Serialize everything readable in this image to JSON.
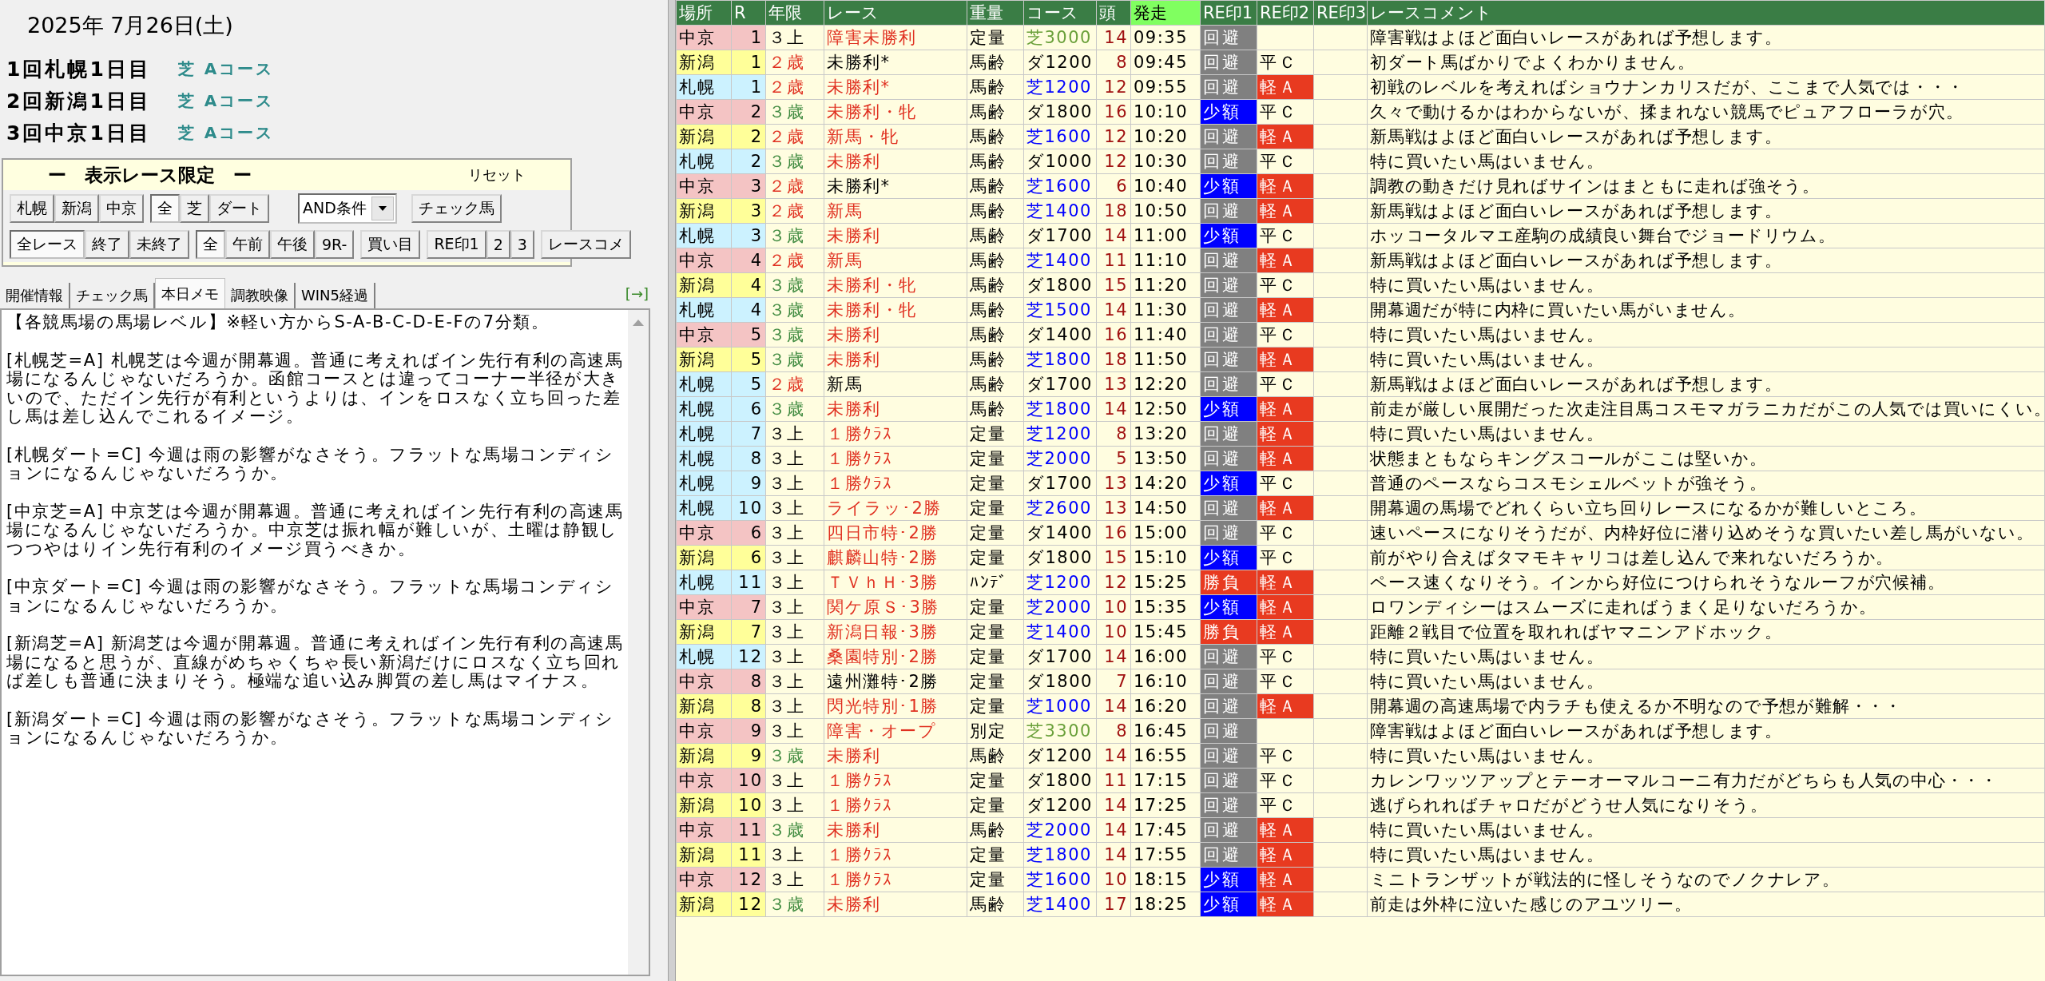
{
  "date": "2025年 7月26日(土)",
  "meetings": [
    {
      "name": "1回札幌1日目",
      "course": "芝 Aコース"
    },
    {
      "name": "2回新潟1日目",
      "course": "芝 Aコース"
    },
    {
      "name": "3回中京1日目",
      "course": "芝 Aコース"
    }
  ],
  "filter": {
    "title": "ー　表示レース限定　ー",
    "reset": "リセット",
    "venue_buttons": [
      {
        "label": "札幌",
        "selected": false
      },
      {
        "label": "新潟",
        "selected": false
      },
      {
        "label": "中京",
        "selected": false
      }
    ],
    "surface_buttons": [
      {
        "label": "全",
        "selected": true
      },
      {
        "label": "芝",
        "selected": false
      },
      {
        "label": "ダート",
        "selected": false
      }
    ],
    "condition": "AND条件",
    "check_button": "チェック馬",
    "status_buttons": [
      {
        "label": "全レース",
        "selected": true
      },
      {
        "label": "終了",
        "selected": false
      },
      {
        "label": "未終了",
        "selected": false
      }
    ],
    "time_buttons": [
      {
        "label": "全",
        "selected": true
      },
      {
        "label": "午前",
        "selected": false
      },
      {
        "label": "午後",
        "selected": false
      },
      {
        "label": "9R-",
        "selected": false
      }
    ],
    "buy_button": "買い目",
    "mark_buttons": [
      {
        "label": "RE印1",
        "selected": false
      },
      {
        "label": "2",
        "selected": false
      },
      {
        "label": "3",
        "selected": false
      }
    ],
    "comment_button": "レースコメ"
  },
  "tabs": [
    {
      "label": "開催情報",
      "selected": false
    },
    {
      "label": "チェック馬",
      "selected": false
    },
    {
      "label": "本日メモ",
      "selected": true
    },
    {
      "label": "調教映像",
      "selected": false
    },
    {
      "label": "WIN5経過",
      "selected": false
    }
  ],
  "tab_link": "[→]",
  "memo": [
    "【各競馬場の馬場レベル】※軽い方からS-A-B-C-D-E-Fの7分類。",
    "[札幌芝=A] 札幌芝は今週が開幕週。普通に考えればイン先行有利の高速馬場になるんじゃないだろうか。函館コースとは違ってコーナー半径が大きいので、ただイン先行が有利というよりは、インをロスなく立ち回った差し馬は差し込んでこれるイメージ。",
    "[札幌ダート=C] 今週は雨の影響がなさそう。フラットな馬場コンディションになるんじゃないだろうか。",
    "[中京芝=A] 中京芝は今週が開幕週。普通に考えればイン先行有利の高速馬場になるんじゃないだろうか。中京芝は振れ幅が難しいが、土曜は静観しつつやはりイン先行有利のイメージ買うべきか。",
    "[中京ダート=C] 今週は雨の影響がなさそう。フラットな馬場コンディションになるんじゃないだろうか。",
    "[新潟芝=A] 新潟芝は今週が開幕週。普通に考えればイン先行有利の高速馬場になると思うが、直線がめちゃくちゃ長い新潟だけにロスなく立ち回れば差しも普通に決まりそう。極端な追い込み脚質の差し馬はマイナス。",
    "[新潟ダート=C] 今週は雨の影響がなさそう。フラットな馬場コンディションになるんじゃないだろうか。"
  ],
  "table": {
    "columns": [
      {
        "label": "場所",
        "selected": false
      },
      {
        "label": "R",
        "selected": false
      },
      {
        "label": "年限",
        "selected": false
      },
      {
        "label": "レース",
        "selected": false
      },
      {
        "label": "重量",
        "selected": false
      },
      {
        "label": "コース",
        "selected": false
      },
      {
        "label": "頭",
        "selected": false
      },
      {
        "label": "発走",
        "selected": true
      },
      {
        "label": "RE印1",
        "selected": false
      },
      {
        "label": "RE印2",
        "selected": false
      },
      {
        "label": "RE印3",
        "selected": false
      },
      {
        "label": "レースコメント",
        "selected": false
      }
    ],
    "rows": [
      {
        "venue": "中京",
        "color": "#f4c4c4",
        "r": "1",
        "age": {
          "text": "３上",
          "kind": "upper"
        },
        "race": "障害未勝利",
        "race_highlight": true,
        "weight": "定量",
        "course": {
          "text": "芝3000",
          "kind": "jump"
        },
        "runners": "14",
        "time": "09:35",
        "mark1": {
          "text": "回避",
          "kind": "avoid"
        },
        "comment": "障害戦はよほど面白いレースがあれば予想します。"
      },
      {
        "venue": "新潟",
        "color": "#ffff99",
        "r": "1",
        "age": {
          "text": "２歳",
          "kind": "two"
        },
        "race": "未勝利*",
        "race_highlight": false,
        "weight": "馬齢",
        "course": {
          "text": "ダ1200",
          "kind": "dirt"
        },
        "runners": "8",
        "time": "09:45",
        "mark1": {
          "text": "回避",
          "kind": "avoid"
        },
        "mark2": {
          "text": "平Ｃ",
          "kind": "flat"
        },
        "comment": "初ダート馬ばかりでよくわかりません。"
      },
      {
        "venue": "札幌",
        "color": "#ccf2ff",
        "r": "1",
        "age": {
          "text": "２歳",
          "kind": "two"
        },
        "race": "未勝利*",
        "race_highlight": true,
        "weight": "馬齢",
        "course": {
          "text": "芝1200",
          "kind": "turf"
        },
        "runners": "12",
        "time": "09:55",
        "mark1": {
          "text": "回避",
          "kind": "avoid"
        },
        "mark2": {
          "text": "軽Ａ",
          "kind": "light"
        },
        "comment": "初戦のレベルを考えればショウナンカリスだが、ここまで人気では・・・"
      },
      {
        "venue": "中京",
        "color": "#f4c4c4",
        "r": "2",
        "age": {
          "text": "３歳",
          "kind": "three"
        },
        "race": "未勝利・牝",
        "race_highlight": true,
        "weight": "馬齢",
        "course": {
          "text": "ダ1800",
          "kind": "dirt"
        },
        "runners": "16",
        "time": "10:10",
        "mark1": {
          "text": "少額",
          "kind": "small"
        },
        "mark2": {
          "text": "平Ｃ",
          "kind": "flat"
        },
        "comment": "久々で動けるかはわからないが、揉まれない競馬でピュアフローラが穴。"
      },
      {
        "venue": "新潟",
        "color": "#ffff99",
        "r": "2",
        "age": {
          "text": "２歳",
          "kind": "two"
        },
        "race": "新馬・牝",
        "race_highlight": true,
        "weight": "馬齢",
        "course": {
          "text": "芝1600",
          "kind": "turf"
        },
        "runners": "12",
        "time": "10:20",
        "mark1": {
          "text": "回避",
          "kind": "avoid"
        },
        "mark2": {
          "text": "軽Ａ",
          "kind": "light"
        },
        "comment": "新馬戦はよほど面白いレースがあれば予想します。"
      },
      {
        "venue": "札幌",
        "color": "#ccf2ff",
        "r": "2",
        "age": {
          "text": "３歳",
          "kind": "three"
        },
        "race": "未勝利",
        "race_highlight": true,
        "weight": "馬齢",
        "course": {
          "text": "ダ1000",
          "kind": "dirt"
        },
        "runners": "12",
        "time": "10:30",
        "mark1": {
          "text": "回避",
          "kind": "avoid"
        },
        "mark2": {
          "text": "平Ｃ",
          "kind": "flat"
        },
        "comment": "特に買いたい馬はいません。"
      },
      {
        "venue": "中京",
        "color": "#f4c4c4",
        "r": "3",
        "age": {
          "text": "２歳",
          "kind": "two"
        },
        "race": "未勝利*",
        "race_highlight": false,
        "weight": "馬齢",
        "course": {
          "text": "芝1600",
          "kind": "turf"
        },
        "runners": "6",
        "time": "10:40",
        "mark1": {
          "text": "少額",
          "kind": "small"
        },
        "mark2": {
          "text": "軽Ａ",
          "kind": "light"
        },
        "comment": "調教の動きだけ見ればサインはまともに走れば強そう。"
      },
      {
        "venue": "新潟",
        "color": "#ffff99",
        "r": "3",
        "age": {
          "text": "２歳",
          "kind": "two"
        },
        "race": "新馬",
        "race_highlight": true,
        "weight": "馬齢",
        "course": {
          "text": "芝1400",
          "kind": "turf"
        },
        "runners": "18",
        "time": "10:50",
        "mark1": {
          "text": "回避",
          "kind": "avoid"
        },
        "mark2": {
          "text": "軽Ａ",
          "kind": "light"
        },
        "comment": "新馬戦はよほど面白いレースがあれば予想します。"
      },
      {
        "venue": "札幌",
        "color": "#ccf2ff",
        "r": "3",
        "age": {
          "text": "３歳",
          "kind": "three"
        },
        "race": "未勝利",
        "race_highlight": true,
        "weight": "馬齢",
        "course": {
          "text": "ダ1700",
          "kind": "dirt"
        },
        "runners": "14",
        "time": "11:00",
        "mark1": {
          "text": "少額",
          "kind": "small"
        },
        "mark2": {
          "text": "平Ｃ",
          "kind": "flat"
        },
        "comment": "ホッコータルマエ産駒の成績良い舞台でジョードリウム。"
      },
      {
        "venue": "中京",
        "color": "#f4c4c4",
        "r": "4",
        "age": {
          "text": "２歳",
          "kind": "two"
        },
        "race": "新馬",
        "race_highlight": true,
        "weight": "馬齢",
        "course": {
          "text": "芝1400",
          "kind": "turf"
        },
        "runners": "11",
        "time": "11:10",
        "mark1": {
          "text": "回避",
          "kind": "avoid"
        },
        "mark2": {
          "text": "軽Ａ",
          "kind": "light"
        },
        "comment": "新馬戦はよほど面白いレースがあれば予想します。"
      },
      {
        "venue": "新潟",
        "color": "#ffff99",
        "r": "4",
        "age": {
          "text": "３歳",
          "kind": "three"
        },
        "race": "未勝利・牝",
        "race_highlight": true,
        "weight": "馬齢",
        "course": {
          "text": "ダ1800",
          "kind": "dirt"
        },
        "runners": "15",
        "time": "11:20",
        "mark1": {
          "text": "回避",
          "kind": "avoid"
        },
        "mark2": {
          "text": "平Ｃ",
          "kind": "flat"
        },
        "comment": "特に買いたい馬はいません。"
      },
      {
        "venue": "札幌",
        "color": "#ccf2ff",
        "r": "4",
        "age": {
          "text": "３歳",
          "kind": "three"
        },
        "race": "未勝利・牝",
        "race_highlight": true,
        "weight": "馬齢",
        "course": {
          "text": "芝1500",
          "kind": "turf"
        },
        "runners": "14",
        "time": "11:30",
        "mark1": {
          "text": "回避",
          "kind": "avoid"
        },
        "mark2": {
          "text": "軽Ａ",
          "kind": "light"
        },
        "comment": "開幕週だが特に内枠に買いたい馬がいません。"
      },
      {
        "venue": "中京",
        "color": "#f4c4c4",
        "r": "5",
        "age": {
          "text": "３歳",
          "kind": "three"
        },
        "race": "未勝利",
        "race_highlight": true,
        "weight": "馬齢",
        "course": {
          "text": "ダ1400",
          "kind": "dirt"
        },
        "runners": "16",
        "time": "11:40",
        "mark1": {
          "text": "回避",
          "kind": "avoid"
        },
        "mark2": {
          "text": "平Ｃ",
          "kind": "flat"
        },
        "comment": "特に買いたい馬はいません。"
      },
      {
        "venue": "新潟",
        "color": "#ffff99",
        "r": "5",
        "age": {
          "text": "３歳",
          "kind": "three"
        },
        "race": "未勝利",
        "race_highlight": true,
        "weight": "馬齢",
        "course": {
          "text": "芝1800",
          "kind": "turf"
        },
        "runners": "18",
        "time": "11:50",
        "mark1": {
          "text": "回避",
          "kind": "avoid"
        },
        "mark2": {
          "text": "軽Ａ",
          "kind": "light"
        },
        "comment": "特に買いたい馬はいません。"
      },
      {
        "venue": "札幌",
        "color": "#ccf2ff",
        "r": "5",
        "age": {
          "text": "２歳",
          "kind": "two"
        },
        "race": "新馬",
        "race_highlight": false,
        "weight": "馬齢",
        "course": {
          "text": "ダ1700",
          "kind": "dirt"
        },
        "runners": "13",
        "time": "12:20",
        "mark1": {
          "text": "回避",
          "kind": "avoid"
        },
        "mark2": {
          "text": "平Ｃ",
          "kind": "flat"
        },
        "comment": "新馬戦はよほど面白いレースがあれば予想します。"
      },
      {
        "venue": "札幌",
        "color": "#ccf2ff",
        "r": "6",
        "age": {
          "text": "３歳",
          "kind": "three"
        },
        "race": "未勝利",
        "race_highlight": true,
        "weight": "馬齢",
        "course": {
          "text": "芝1800",
          "kind": "turf"
        },
        "runners": "14",
        "time": "12:50",
        "mark1": {
          "text": "少額",
          "kind": "small"
        },
        "mark2": {
          "text": "軽Ａ",
          "kind": "light"
        },
        "comment": "前走が厳しい展開だった次走注目馬コスモマガラニカだがこの人気では買いにくい。"
      },
      {
        "venue": "札幌",
        "color": "#ccf2ff",
        "r": "7",
        "age": {
          "text": "３上",
          "kind": "upper"
        },
        "race": "１勝ｸﾗｽ",
        "race_highlight": true,
        "weight": "定量",
        "course": {
          "text": "芝1200",
          "kind": "turf"
        },
        "runners": "8",
        "time": "13:20",
        "mark1": {
          "text": "回避",
          "kind": "avoid"
        },
        "mark2": {
          "text": "軽Ａ",
          "kind": "light"
        },
        "comment": "特に買いたい馬はいません。"
      },
      {
        "venue": "札幌",
        "color": "#ccf2ff",
        "r": "8",
        "age": {
          "text": "３上",
          "kind": "upper"
        },
        "race": "１勝ｸﾗｽ",
        "race_highlight": true,
        "weight": "定量",
        "course": {
          "text": "芝2000",
          "kind": "turf"
        },
        "runners": "5",
        "time": "13:50",
        "mark1": {
          "text": "回避",
          "kind": "avoid"
        },
        "mark2": {
          "text": "軽Ａ",
          "kind": "light"
        },
        "comment": "状態まともならキングスコールがここは堅いか。"
      },
      {
        "venue": "札幌",
        "color": "#ccf2ff",
        "r": "9",
        "age": {
          "text": "３上",
          "kind": "upper"
        },
        "race": "１勝ｸﾗｽ",
        "race_highlight": true,
        "weight": "定量",
        "course": {
          "text": "ダ1700",
          "kind": "dirt"
        },
        "runners": "13",
        "time": "14:20",
        "mark1": {
          "text": "少額",
          "kind": "small"
        },
        "mark2": {
          "text": "平Ｃ",
          "kind": "flat"
        },
        "comment": "普通のペースならコスモシェルベットが強そう。"
      },
      {
        "venue": "札幌",
        "color": "#ccf2ff",
        "r": "10",
        "age": {
          "text": "３上",
          "kind": "upper"
        },
        "race": "ライラッ･2勝",
        "race_highlight": true,
        "weight": "定量",
        "course": {
          "text": "芝2600",
          "kind": "turf"
        },
        "runners": "13",
        "time": "14:50",
        "mark1": {
          "text": "回避",
          "kind": "avoid"
        },
        "mark2": {
          "text": "軽Ａ",
          "kind": "light"
        },
        "comment": "開幕週の馬場でどれくらい立ち回りレースになるかが難しいところ。"
      },
      {
        "venue": "中京",
        "color": "#f4c4c4",
        "r": "6",
        "age": {
          "text": "３上",
          "kind": "upper"
        },
        "race": "四日市特･2勝",
        "race_highlight": true,
        "weight": "定量",
        "course": {
          "text": "ダ1400",
          "kind": "dirt"
        },
        "runners": "16",
        "time": "15:00",
        "mark1": {
          "text": "回避",
          "kind": "avoid"
        },
        "mark2": {
          "text": "平Ｃ",
          "kind": "flat"
        },
        "comment": "速いペースになりそうだが、内枠好位に潜り込めそうな買いたい差し馬がいない。"
      },
      {
        "venue": "新潟",
        "color": "#ffff99",
        "r": "6",
        "age": {
          "text": "３上",
          "kind": "upper"
        },
        "race": "麒麟山特･2勝",
        "race_highlight": true,
        "weight": "定量",
        "course": {
          "text": "ダ1800",
          "kind": "dirt"
        },
        "runners": "15",
        "time": "15:10",
        "mark1": {
          "text": "少額",
          "kind": "small"
        },
        "mark2": {
          "text": "平Ｃ",
          "kind": "flat"
        },
        "comment": "前がやり合えばタマモキャリコは差し込んで来れないだろうか。"
      },
      {
        "venue": "札幌",
        "color": "#ccf2ff",
        "r": "11",
        "age": {
          "text": "３上",
          "kind": "upper"
        },
        "race": "ＴＶｈＨ･3勝",
        "race_highlight": true,
        "weight": "ﾊﾝﾃﾞ",
        "course": {
          "text": "芝1200",
          "kind": "turf"
        },
        "runners": "12",
        "time": "15:25",
        "mark1": {
          "text": "勝負",
          "kind": "bet"
        },
        "mark2": {
          "text": "軽Ａ",
          "kind": "light"
        },
        "comment": "ペース速くなりそう。インから好位につけられそうなルーフが穴候補。"
      },
      {
        "venue": "中京",
        "color": "#f4c4c4",
        "r": "7",
        "age": {
          "text": "３上",
          "kind": "upper"
        },
        "race": "関ケ原Ｓ･3勝",
        "race_highlight": true,
        "weight": "定量",
        "course": {
          "text": "芝2000",
          "kind": "turf"
        },
        "runners": "10",
        "time": "15:35",
        "mark1": {
          "text": "少額",
          "kind": "small"
        },
        "mark2": {
          "text": "軽Ａ",
          "kind": "light"
        },
        "comment": "ロワンディシーはスムーズに走ればうまく足りないだろうか。"
      },
      {
        "venue": "新潟",
        "color": "#ffff99",
        "r": "7",
        "age": {
          "text": "３上",
          "kind": "upper"
        },
        "race": "新潟日報･3勝",
        "race_highlight": true,
        "weight": "定量",
        "course": {
          "text": "芝1400",
          "kind": "turf"
        },
        "runners": "10",
        "time": "15:45",
        "mark1": {
          "text": "勝負",
          "kind": "bet"
        },
        "mark2": {
          "text": "軽Ａ",
          "kind": "light"
        },
        "comment": "距離２戦目で位置を取れればヤマニンアドホック。"
      },
      {
        "venue": "札幌",
        "color": "#ccf2ff",
        "r": "12",
        "age": {
          "text": "３上",
          "kind": "upper"
        },
        "race": "桑園特別･2勝",
        "race_highlight": true,
        "weight": "定量",
        "course": {
          "text": "ダ1700",
          "kind": "dirt"
        },
        "runners": "14",
        "time": "16:00",
        "mark1": {
          "text": "回避",
          "kind": "avoid"
        },
        "mark2": {
          "text": "平Ｃ",
          "kind": "flat"
        },
        "comment": "特に買いたい馬はいません。"
      },
      {
        "venue": "中京",
        "color": "#f4c4c4",
        "r": "8",
        "age": {
          "text": "３上",
          "kind": "upper"
        },
        "race": "遠州灘特･2勝",
        "race_highlight": false,
        "weight": "定量",
        "course": {
          "text": "ダ1800",
          "kind": "dirt"
        },
        "runners": "7",
        "time": "16:10",
        "mark1": {
          "text": "回避",
          "kind": "avoid"
        },
        "mark2": {
          "text": "平Ｃ",
          "kind": "flat"
        },
        "comment": "特に買いたい馬はいません。"
      },
      {
        "venue": "新潟",
        "color": "#ffff99",
        "r": "8",
        "age": {
          "text": "３上",
          "kind": "upper"
        },
        "race": "閃光特別･1勝",
        "race_highlight": true,
        "weight": "定量",
        "course": {
          "text": "芝1000",
          "kind": "turf"
        },
        "runners": "14",
        "time": "16:20",
        "mark1": {
          "text": "回避",
          "kind": "avoid"
        },
        "mark2": {
          "text": "軽Ａ",
          "kind": "light"
        },
        "comment": "開幕週の高速馬場で内ラチも使えるか不明なので予想が難解・・・"
      },
      {
        "venue": "中京",
        "color": "#f4c4c4",
        "r": "9",
        "age": {
          "text": "３上",
          "kind": "upper"
        },
        "race": "障害・オープ",
        "race_highlight": true,
        "weight": "別定",
        "course": {
          "text": "芝3300",
          "kind": "jump"
        },
        "runners": "8",
        "time": "16:45",
        "mark1": {
          "text": "回避",
          "kind": "avoid"
        },
        "comment": "障害戦はよほど面白いレースがあれば予想します。"
      },
      {
        "venue": "新潟",
        "color": "#ffff99",
        "r": "9",
        "age": {
          "text": "３歳",
          "kind": "three"
        },
        "race": "未勝利",
        "race_highlight": true,
        "weight": "馬齢",
        "course": {
          "text": "ダ1200",
          "kind": "dirt"
        },
        "runners": "14",
        "time": "16:55",
        "mark1": {
          "text": "回避",
          "kind": "avoid"
        },
        "mark2": {
          "text": "平Ｃ",
          "kind": "flat"
        },
        "comment": "特に買いたい馬はいません。"
      },
      {
        "venue": "中京",
        "color": "#f4c4c4",
        "r": "10",
        "age": {
          "text": "３上",
          "kind": "upper"
        },
        "race": "１勝ｸﾗｽ",
        "race_highlight": true,
        "weight": "定量",
        "course": {
          "text": "ダ1800",
          "kind": "dirt"
        },
        "runners": "11",
        "time": "17:15",
        "mark1": {
          "text": "回避",
          "kind": "avoid"
        },
        "mark2": {
          "text": "平Ｃ",
          "kind": "flat"
        },
        "comment": "カレンワッツアップとテーオーマルコーニ有力だがどちらも人気の中心・・・"
      },
      {
        "venue": "新潟",
        "color": "#ffff99",
        "r": "10",
        "age": {
          "text": "３上",
          "kind": "upper"
        },
        "race": "１勝ｸﾗｽ",
        "race_highlight": true,
        "weight": "定量",
        "course": {
          "text": "ダ1200",
          "kind": "dirt"
        },
        "runners": "14",
        "time": "17:25",
        "mark1": {
          "text": "回避",
          "kind": "avoid"
        },
        "mark2": {
          "text": "平Ｃ",
          "kind": "flat"
        },
        "comment": "逃げられればチャロだがどうせ人気になりそう。"
      },
      {
        "venue": "中京",
        "color": "#f4c4c4",
        "r": "11",
        "age": {
          "text": "３歳",
          "kind": "three"
        },
        "race": "未勝利",
        "race_highlight": true,
        "weight": "馬齢",
        "course": {
          "text": "芝2000",
          "kind": "turf"
        },
        "runners": "14",
        "time": "17:45",
        "mark1": {
          "text": "回避",
          "kind": "avoid"
        },
        "mark2": {
          "text": "軽Ａ",
          "kind": "light"
        },
        "comment": "特に買いたい馬はいません。"
      },
      {
        "venue": "新潟",
        "color": "#ffff99",
        "r": "11",
        "age": {
          "text": "３上",
          "kind": "upper"
        },
        "race": "１勝ｸﾗｽ",
        "race_highlight": true,
        "weight": "定量",
        "course": {
          "text": "芝1800",
          "kind": "turf"
        },
        "runners": "14",
        "time": "17:55",
        "mark1": {
          "text": "回避",
          "kind": "avoid"
        },
        "mark2": {
          "text": "軽Ａ",
          "kind": "light"
        },
        "comment": "特に買いたい馬はいません。"
      },
      {
        "venue": "中京",
        "color": "#f4c4c4",
        "r": "12",
        "age": {
          "text": "３上",
          "kind": "upper"
        },
        "race": "１勝ｸﾗｽ",
        "race_highlight": true,
        "weight": "定量",
        "course": {
          "text": "芝1600",
          "kind": "turf"
        },
        "runners": "10",
        "time": "18:15",
        "mark1": {
          "text": "少額",
          "kind": "small"
        },
        "mark2": {
          "text": "軽Ａ",
          "kind": "light"
        },
        "comment": "ミニトランザットが戦法的に怪しそうなのでノクナレア。"
      },
      {
        "venue": "新潟",
        "color": "#ffff99",
        "r": "12",
        "age": {
          "text": "３歳",
          "kind": "three"
        },
        "race": "未勝利",
        "race_highlight": true,
        "weight": "馬齢",
        "course": {
          "text": "芝1400",
          "kind": "turf"
        },
        "runners": "17",
        "time": "18:25",
        "mark1": {
          "text": "少額",
          "kind": "small"
        },
        "mark2": {
          "text": "軽Ａ",
          "kind": "light"
        },
        "comment": "前走は外枠に泣いた感じのアユツリー。"
      }
    ]
  }
}
